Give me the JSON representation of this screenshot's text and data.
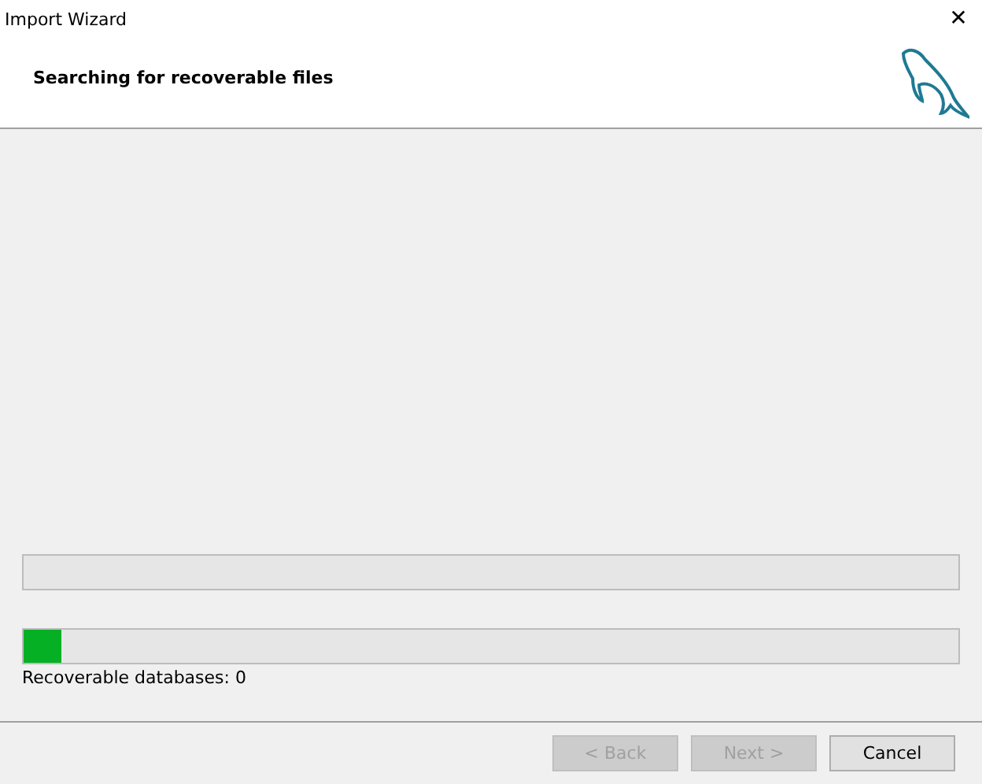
{
  "window": {
    "title": "Import Wizard",
    "close": "✕"
  },
  "header": {
    "title": "Searching for recoverable files"
  },
  "progress_bars": [
    {
      "level": 0
    },
    {
      "level": 0.04
    }
  ],
  "status": "Recoverable databases: 0",
  "buttons": [
    {
      "label": "< Back",
      "disabled": true
    },
    {
      "label": "Next >",
      "disabled": true
    },
    {
      "label": "Cancel",
      "disabled": false
    }
  ]
}
